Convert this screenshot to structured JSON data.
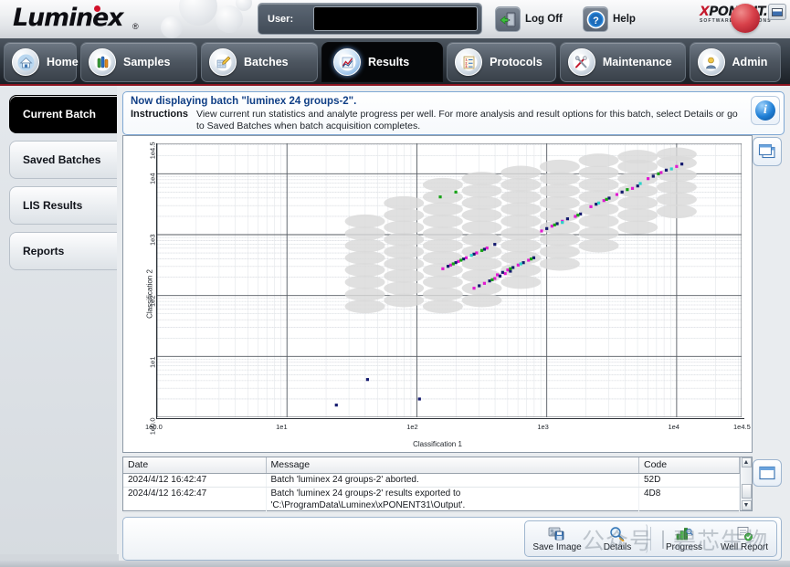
{
  "app": {
    "brand": "Luminex",
    "brand_registered": "®",
    "suite_name": "XPONENT",
    "suite_x": "X",
    "suite_rest": "PONENT.",
    "suite_tagline": "SOFTWARE SOLUTIONS"
  },
  "header": {
    "user_label": "User:",
    "user_value": "",
    "log_off_label": "Log Off",
    "log_off_icon": "door-exit-icon",
    "help_label": "Help",
    "help_icon": "question-circle-icon",
    "window_icon": "minimize-window-icon"
  },
  "tabs": [
    {
      "label": "Home",
      "icon": "house-icon",
      "active": false
    },
    {
      "label": "Samples",
      "icon": "test-tubes-icon",
      "active": false
    },
    {
      "label": "Batches",
      "icon": "pencil-grid-icon",
      "active": false
    },
    {
      "label": "Results",
      "icon": "line-chart-icon",
      "active": true
    },
    {
      "label": "Protocols",
      "icon": "checklist-icon",
      "active": false
    },
    {
      "label": "Maintenance",
      "icon": "tools-icon",
      "active": false
    },
    {
      "label": "Admin",
      "icon": "person-gear-icon",
      "active": false
    }
  ],
  "sidebar": {
    "items": [
      {
        "label": "Current Batch",
        "active": true
      },
      {
        "label": "Saved Batches",
        "active": false
      },
      {
        "label": "LIS Results",
        "active": false
      },
      {
        "label": "Reports",
        "active": false
      }
    ]
  },
  "instructions": {
    "title": "Now displaying batch \"luminex 24 groups-2\".",
    "label": "Instructions",
    "text": "View current run statistics and analyte progress per well. For more analysis and result options for this batch, select Details or go to Saved Batches when batch acquisition completes.",
    "info_icon": "info-circle-icon"
  },
  "chart_panel": {
    "expand_icon": "cascade-windows-icon",
    "zoom_in_label": "+",
    "zoom_out_label": "−",
    "slider_name": "chart-zoom-slider"
  },
  "chart_data": {
    "type": "scatter",
    "title": "",
    "xlabel": "Classification 1",
    "ylabel": "Classification 2",
    "xscale": "log",
    "yscale": "log",
    "xlim": [
      0,
      4.5
    ],
    "ylim": [
      0,
      4.5
    ],
    "xticks": [
      "1e0.0",
      "1e1",
      "1e2",
      "1e3",
      "1e4",
      "1e4.5"
    ],
    "yticks": [
      "1e0.0",
      "1e1",
      "1e2",
      "1e3",
      "1e4",
      "1e4.5"
    ],
    "xtick_values": [
      0,
      1,
      2,
      3,
      4,
      4.5
    ],
    "ytick_values": [
      0,
      1,
      2,
      3,
      4,
      4.5
    ],
    "grid": true,
    "legend": false,
    "series": [
      {
        "name": "bead regions",
        "marker": "ellipse",
        "color": "#d9d9d9",
        "note": "gray elliptical classification regions arranged in a diagonal lattice",
        "points": [
          [
            1.6,
            3.22
          ],
          [
            1.6,
            3.02
          ],
          [
            1.6,
            2.82
          ],
          [
            1.6,
            2.62
          ],
          [
            1.6,
            2.42
          ],
          [
            1.6,
            2.22
          ],
          [
            1.6,
            2.02
          ],
          [
            1.6,
            1.82
          ],
          [
            1.9,
            3.52
          ],
          [
            1.9,
            3.32
          ],
          [
            1.9,
            3.12
          ],
          [
            1.9,
            2.92
          ],
          [
            1.9,
            2.72
          ],
          [
            1.9,
            2.52
          ],
          [
            1.9,
            2.32
          ],
          [
            1.9,
            2.12
          ],
          [
            1.9,
            1.92
          ],
          [
            2.2,
            3.82
          ],
          [
            2.2,
            3.62
          ],
          [
            2.2,
            3.42
          ],
          [
            2.2,
            3.22
          ],
          [
            2.2,
            3.02
          ],
          [
            2.2,
            2.82
          ],
          [
            2.2,
            2.62
          ],
          [
            2.2,
            2.42
          ],
          [
            2.2,
            2.22
          ],
          [
            2.2,
            2.02
          ],
          [
            2.2,
            1.82
          ],
          [
            2.5,
            3.92
          ],
          [
            2.5,
            3.72
          ],
          [
            2.5,
            3.52
          ],
          [
            2.5,
            3.32
          ],
          [
            2.5,
            3.12
          ],
          [
            2.5,
            2.92
          ],
          [
            2.5,
            2.72
          ],
          [
            2.5,
            2.52
          ],
          [
            2.5,
            2.32
          ],
          [
            2.5,
            2.12
          ],
          [
            2.5,
            1.92
          ],
          [
            2.8,
            4.02
          ],
          [
            2.8,
            3.82
          ],
          [
            2.8,
            3.62
          ],
          [
            2.8,
            3.42
          ],
          [
            2.8,
            3.22
          ],
          [
            2.8,
            3.02
          ],
          [
            2.8,
            2.82
          ],
          [
            2.8,
            2.62
          ],
          [
            2.8,
            2.42
          ],
          [
            2.8,
            2.22
          ],
          [
            3.1,
            4.12
          ],
          [
            3.1,
            3.92
          ],
          [
            3.1,
            3.72
          ],
          [
            3.1,
            3.52
          ],
          [
            3.1,
            3.32
          ],
          [
            3.1,
            3.12
          ],
          [
            3.1,
            2.92
          ],
          [
            3.1,
            2.72
          ],
          [
            3.1,
            2.52
          ],
          [
            3.4,
            4.22
          ],
          [
            3.4,
            4.02
          ],
          [
            3.4,
            3.82
          ],
          [
            3.4,
            3.62
          ],
          [
            3.4,
            3.42
          ],
          [
            3.4,
            3.22
          ],
          [
            3.4,
            3.02
          ],
          [
            3.4,
            2.82
          ],
          [
            3.7,
            4.28
          ],
          [
            3.7,
            4.12
          ],
          [
            3.7,
            3.92
          ],
          [
            3.7,
            3.72
          ],
          [
            3.7,
            3.52
          ],
          [
            3.7,
            3.32
          ],
          [
            3.7,
            3.12
          ],
          [
            4.0,
            4.32
          ],
          [
            4.0,
            4.18
          ],
          [
            4.0,
            3.98
          ],
          [
            4.0,
            3.78
          ],
          [
            4.0,
            3.58
          ],
          [
            4.0,
            3.38
          ]
        ]
      },
      {
        "name": "bead events (magenta)",
        "marker": "square",
        "color": "#e11ad1",
        "points": [
          [
            2.2,
            2.44
          ],
          [
            2.26,
            2.5
          ],
          [
            2.32,
            2.56
          ],
          [
            2.38,
            2.62
          ],
          [
            2.46,
            2.7
          ],
          [
            2.54,
            2.78
          ],
          [
            2.62,
            2.34
          ],
          [
            2.7,
            2.42
          ],
          [
            2.78,
            2.5
          ],
          [
            2.86,
            2.58
          ],
          [
            2.96,
            3.06
          ],
          [
            3.04,
            3.14
          ],
          [
            3.12,
            3.22
          ],
          [
            3.22,
            3.3
          ],
          [
            3.34,
            3.46
          ],
          [
            3.44,
            3.56
          ],
          [
            3.54,
            3.66
          ],
          [
            3.66,
            3.76
          ],
          [
            3.78,
            3.92
          ],
          [
            3.88,
            4.02
          ],
          [
            4.0,
            4.12
          ],
          [
            2.44,
            2.12
          ],
          [
            2.52,
            2.2
          ],
          [
            2.6,
            2.28
          ],
          [
            2.68,
            2.36
          ]
        ]
      },
      {
        "name": "bead events (navy)",
        "marker": "square",
        "color": "#141a6e",
        "points": [
          [
            2.24,
            2.48
          ],
          [
            2.3,
            2.54
          ],
          [
            2.36,
            2.6
          ],
          [
            2.44,
            2.68
          ],
          [
            2.52,
            2.76
          ],
          [
            2.6,
            2.84
          ],
          [
            2.66,
            2.38
          ],
          [
            2.74,
            2.46
          ],
          [
            2.82,
            2.54
          ],
          [
            2.9,
            2.62
          ],
          [
            3.0,
            3.1
          ],
          [
            3.08,
            3.18
          ],
          [
            3.16,
            3.26
          ],
          [
            3.26,
            3.34
          ],
          [
            3.38,
            3.5
          ],
          [
            3.48,
            3.6
          ],
          [
            3.58,
            3.7
          ],
          [
            3.7,
            3.8
          ],
          [
            3.82,
            3.96
          ],
          [
            3.92,
            4.06
          ],
          [
            4.04,
            4.16
          ],
          [
            2.48,
            2.16
          ],
          [
            2.56,
            2.24
          ],
          [
            2.64,
            2.32
          ],
          [
            2.72,
            2.4
          ],
          [
            1.62,
            0.62
          ],
          [
            1.38,
            0.2
          ],
          [
            2.02,
            0.3
          ]
        ]
      },
      {
        "name": "bead events (green)",
        "marker": "square",
        "color": "#17a217",
        "points": [
          [
            2.34,
            2.58
          ],
          [
            2.5,
            2.74
          ],
          [
            2.72,
            2.44
          ],
          [
            2.88,
            2.6
          ],
          [
            3.06,
            3.16
          ],
          [
            3.24,
            3.32
          ],
          [
            3.46,
            3.58
          ],
          [
            3.62,
            3.74
          ],
          [
            3.86,
            4.0
          ],
          [
            2.58,
            2.26
          ],
          [
            2.28,
            2.52
          ],
          [
            2.18,
            3.62
          ],
          [
            2.3,
            3.7
          ]
        ]
      },
      {
        "name": "bead events (cyan)",
        "marker": "square",
        "color": "#2ed2c9",
        "points": [
          [
            3.12,
            3.2
          ],
          [
            3.4,
            3.52
          ],
          [
            3.72,
            3.84
          ],
          [
            2.42,
            2.66
          ],
          [
            2.8,
            2.52
          ],
          [
            3.96,
            4.08
          ]
        ]
      }
    ]
  },
  "log_table": {
    "expand_icon": "expand-table-icon",
    "columns": [
      "Date",
      "Message",
      "Code"
    ],
    "rows": [
      {
        "date": "2024/4/12 16:42:47",
        "message": "Batch 'luminex 24 groups-2' aborted.",
        "code": "52D"
      },
      {
        "date": "2024/4/12 16:42:47",
        "message": "Batch 'luminex 24 groups-2' results exported to 'C:\\ProgramData\\Luminex\\xPONENT31\\Output'.",
        "code": "4D8"
      }
    ]
  },
  "actions": [
    {
      "label": "Save Image",
      "icon": "save-image-icon"
    },
    {
      "label": "Details",
      "icon": "magnifier-icon"
    },
    {
      "label": "Progress",
      "icon": "progress-chart-icon"
    },
    {
      "label": "Well Report",
      "icon": "well-report-icon"
    }
  ],
  "watermark": {
    "left": "公众号",
    "right": "碧芯生物"
  },
  "colors": {
    "accent_blue": "#1f7fd6",
    "header_title_blue": "#103f86",
    "tab_active_bg": "#050608",
    "red_rule": "#8d1420"
  }
}
